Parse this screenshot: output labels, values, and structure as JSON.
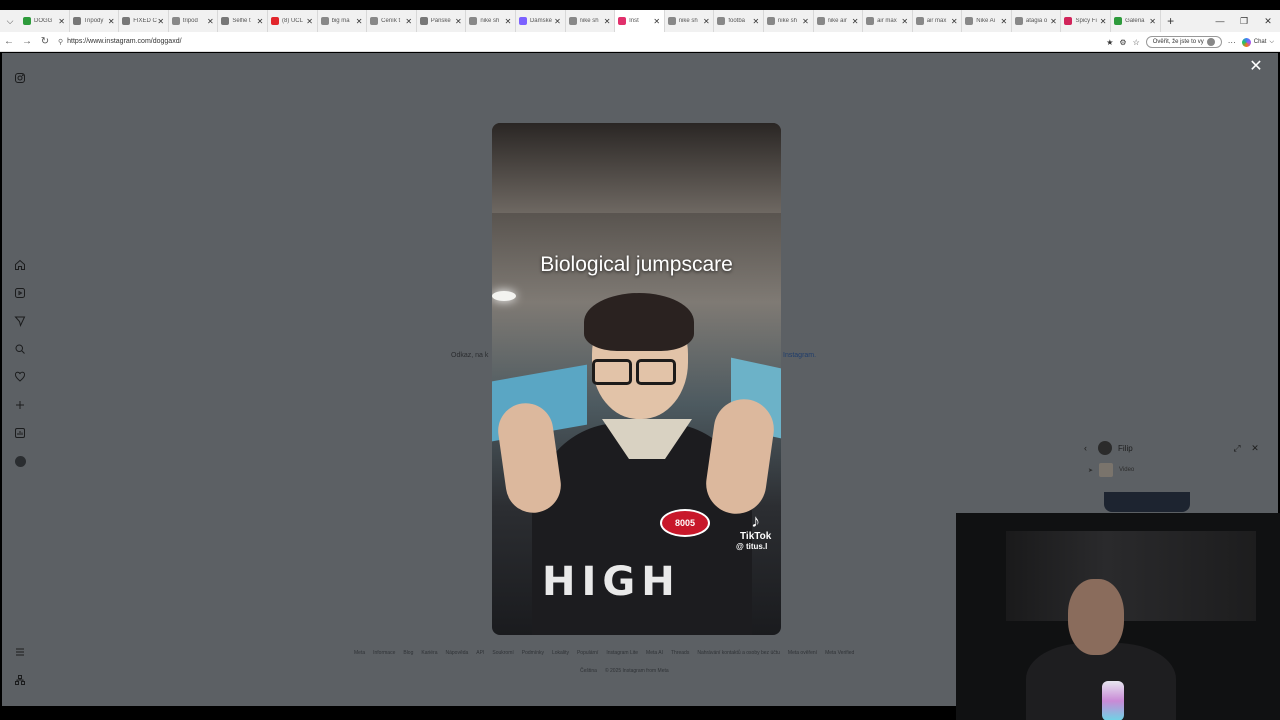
{
  "browser": {
    "tabs": [
      {
        "label": "DOGG",
        "fav_color": "#2e9b3c"
      },
      {
        "label": "Tripody",
        "fav_color": "#777777"
      },
      {
        "label": "FIXED C",
        "fav_color": "#777777"
      },
      {
        "label": "tripod",
        "fav_color": "#888888"
      },
      {
        "label": "Selfie t",
        "fav_color": "#777777"
      },
      {
        "label": "(8) UCL",
        "fav_color": "#e2262c"
      },
      {
        "label": "big ma",
        "fav_color": "#888888"
      },
      {
        "label": "Ceník t",
        "fav_color": "#888888"
      },
      {
        "label": "Pánské",
        "fav_color": "#777777"
      },
      {
        "label": "nike sh",
        "fav_color": "#888888"
      },
      {
        "label": "Dámské",
        "fav_color": "#7b61ff"
      },
      {
        "label": "nike sh",
        "fav_color": "#888888"
      },
      {
        "label": "Inst",
        "fav_color": "#e1306c",
        "active": true
      },
      {
        "label": "nike sh",
        "fav_color": "#888888"
      },
      {
        "label": "footba",
        "fav_color": "#888888"
      },
      {
        "label": "nike sh",
        "fav_color": "#888888"
      },
      {
        "label": "nike air",
        "fav_color": "#888888"
      },
      {
        "label": "air max",
        "fav_color": "#888888"
      },
      {
        "label": "air max",
        "fav_color": "#888888"
      },
      {
        "label": "Nike Ai",
        "fav_color": "#888888"
      },
      {
        "label": "atagia o",
        "fav_color": "#888888"
      },
      {
        "label": "Spicy Fi",
        "fav_color": "#d1245a"
      },
      {
        "label": "Galeria",
        "fav_color": "#2e9b3c"
      }
    ],
    "url": "https://www.instagram.com/doggaxd/",
    "verify_label": "Ověřit, že jste to vy",
    "chat_label": "Chat"
  },
  "page": {
    "background_text_left": "Odkaz, na k",
    "background_text_right": "Instagram.",
    "footer_links": [
      "Meta",
      "Informace",
      "Blog",
      "Kariéra",
      "Nápověda",
      "API",
      "Soukromí",
      "Podmínky",
      "Lokality",
      "Populární",
      "Instagram Lite",
      "Meta AI",
      "Threads",
      "Nahrávání kontaktů a osoby bez účtu",
      "Meta ověření",
      "Meta Verified"
    ],
    "footer_language": "Čeština",
    "footer_copyright": "© 2025 Instagram from Meta"
  },
  "video": {
    "caption": "Biological jumpscare",
    "watermark_brand": "TikTok",
    "watermark_handle": "@ titus.l",
    "shirt_text": "HIGH",
    "patch_text": "8005"
  },
  "chat_widget": {
    "contact_name": "Filip",
    "message_preview": "Video"
  }
}
